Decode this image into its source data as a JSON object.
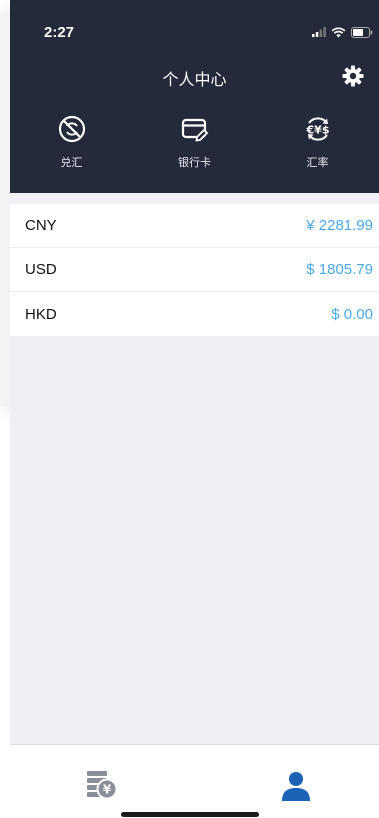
{
  "status_bar": {
    "time": "2:27"
  },
  "header": {
    "title": "个人中心",
    "settings_icon": "gear-icon"
  },
  "actions": [
    {
      "label": "兑汇",
      "icon": "no-exchange-icon"
    },
    {
      "label": "银行卡",
      "icon": "bank-card-icon"
    },
    {
      "label": "汇率",
      "icon": "exchange-rate-icon"
    }
  ],
  "balances": [
    {
      "currency": "CNY",
      "amount": "¥ 2281.99"
    },
    {
      "currency": "USD",
      "amount": "$ 1805.79"
    },
    {
      "currency": "HKD",
      "amount": "$ 0.00"
    }
  ],
  "tabbar": {
    "tabs": [
      {
        "icon": "wallet-yen-icon",
        "active": false
      },
      {
        "icon": "person-icon",
        "active": true
      }
    ]
  },
  "colors": {
    "header_bg": "#252a3b",
    "amount": "#4aa8e8",
    "active_tab": "#1c63b7",
    "inactive_tab": "#8a8e99"
  }
}
